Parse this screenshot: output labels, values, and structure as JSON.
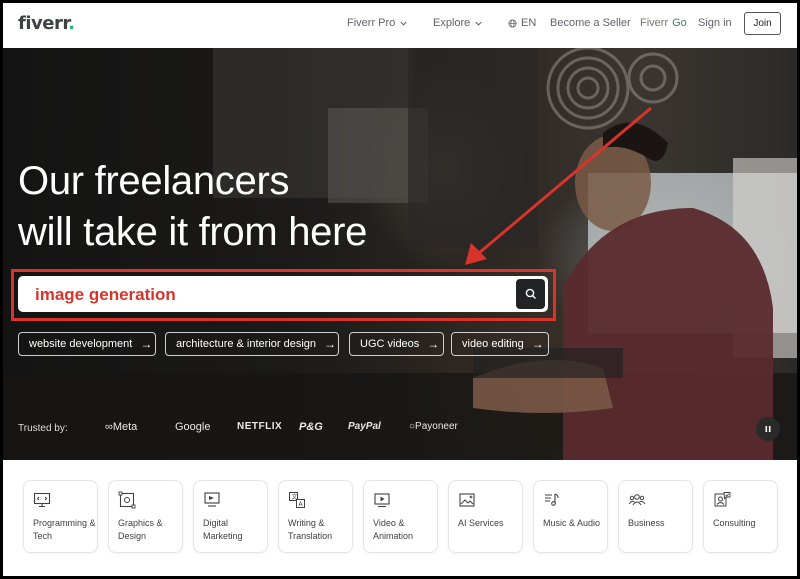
{
  "header": {
    "logo_text": "fiverr",
    "logo_dot": ".",
    "nav": [
      {
        "label": "Fiverr Pro",
        "dropdown": true
      },
      {
        "label": "Explore",
        "dropdown": true
      },
      {
        "label": "EN",
        "icon": "globe-icon"
      },
      {
        "label": "Become a Seller"
      },
      {
        "label_a": "Fiverr ",
        "label_b": "Go"
      },
      {
        "label": "Sign in"
      }
    ],
    "join_label": "Join"
  },
  "hero": {
    "title_line1": "Our freelancers",
    "title_line2": "will take it from here",
    "search_value": "image generation",
    "chips": [
      "website development",
      "architecture & interior design",
      "UGC videos",
      "video editing"
    ],
    "chip_arrow": "→",
    "trusted_label": "Trusted by:",
    "brands": [
      "Meta",
      "Google",
      "NETFLIX",
      "P&G",
      "PayPal",
      "Payoneer"
    ]
  },
  "categories": [
    {
      "label": "Programming & Tech",
      "icon": "monitor-code-icon"
    },
    {
      "label": "Graphics & Design",
      "icon": "pen-tool-icon"
    },
    {
      "label": "Digital Marketing",
      "icon": "marketing-screen-icon"
    },
    {
      "label": "Writing & Translation",
      "icon": "translate-icon"
    },
    {
      "label": "Video & Animation",
      "icon": "play-screen-icon"
    },
    {
      "label": "AI Services",
      "icon": "ai-image-icon"
    },
    {
      "label": "Music & Audio",
      "icon": "music-note-icon"
    },
    {
      "label": "Business",
      "icon": "people-icon"
    },
    {
      "label": "Consulting",
      "icon": "consulting-icon"
    }
  ],
  "colors": {
    "accent_green": "#1dbf73",
    "annotation_red": "#d9342b",
    "text_dark": "#404145"
  }
}
